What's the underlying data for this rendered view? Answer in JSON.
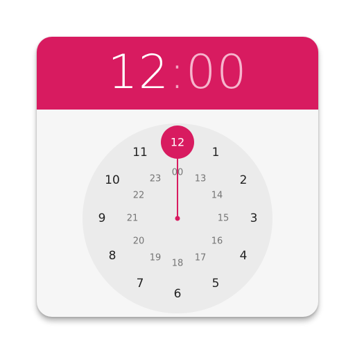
{
  "header": {
    "hours": "12",
    "separator": ":",
    "minutes": "00"
  },
  "dial": {
    "selected": "12",
    "outer": [
      "1",
      "2",
      "3",
      "4",
      "5",
      "6",
      "7",
      "8",
      "9",
      "10",
      "11"
    ],
    "inner": [
      "00",
      "13",
      "14",
      "15",
      "16",
      "17",
      "18",
      "19",
      "20",
      "21",
      "22",
      "23"
    ]
  },
  "colors": {
    "accent": "#d81b60",
    "minutes_dim": "#f6b5cd",
    "face": "#ebebeb",
    "body": "#f6f6f6"
  }
}
